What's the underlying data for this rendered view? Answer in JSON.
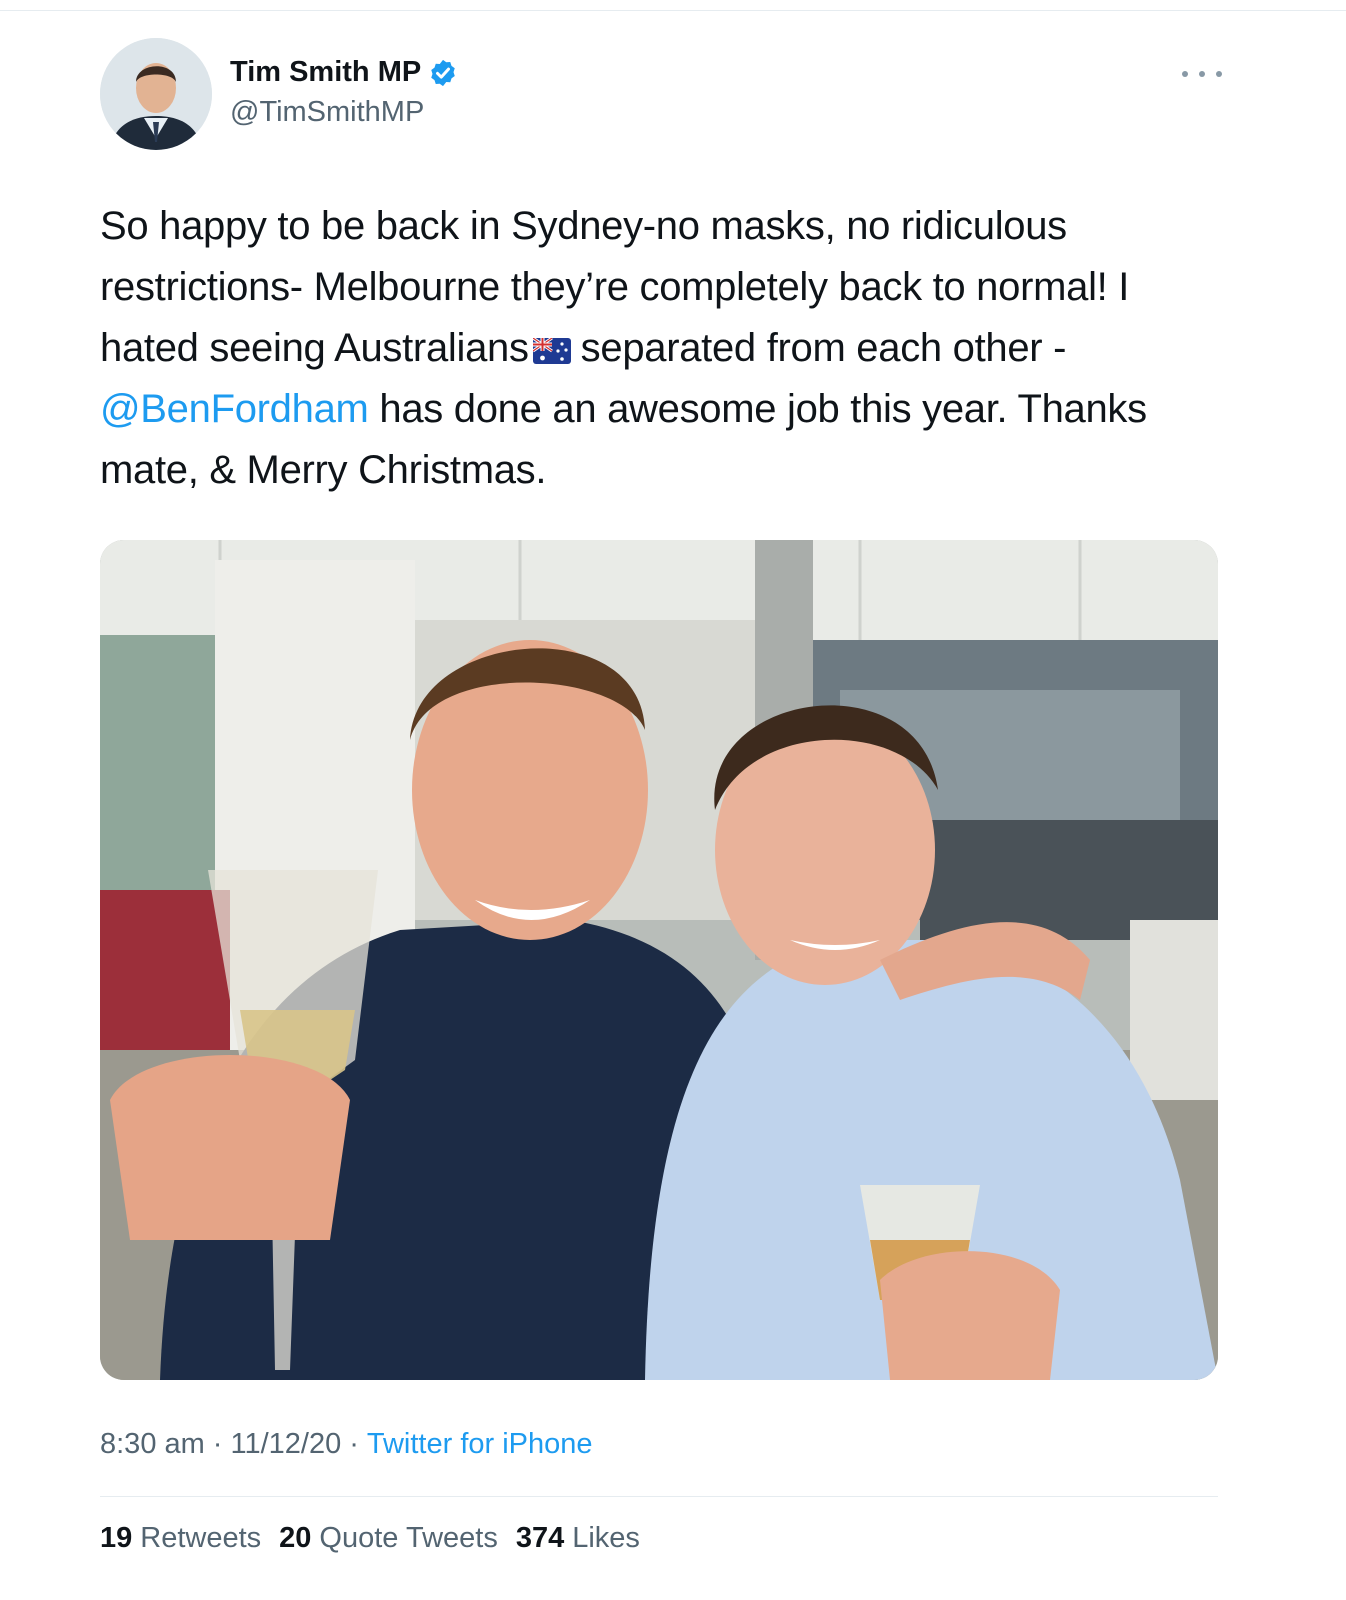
{
  "author": {
    "display_name": "Tim Smith MP",
    "handle": "@TimSmithMP",
    "verified": true
  },
  "tweet": {
    "lines": [
      "So happy to be back in Sydney-no masks, no ridiculous",
      "restrictions- Melbourne they’re completely back to normal! I",
      "hated seeing Australians",
      "separated from each other -",
      "@BenFordham",
      "has done an awesome job this year. Thanks",
      "mate, & Merry Christmas."
    ],
    "emoji": "australia-flag-icon"
  },
  "meta": {
    "time": "8:30 am",
    "separator": "·",
    "date": "11/12/20",
    "source": "Twitter for iPhone"
  },
  "stats": {
    "retweets_count": "19",
    "retweets_label": "Retweets",
    "quotes_count": "20",
    "quotes_label": "Quote Tweets",
    "likes_count": "374",
    "likes_label": "Likes"
  },
  "colors": {
    "accent": "#1d9bf0",
    "text": "#0f1419",
    "secondary": "#536471"
  }
}
